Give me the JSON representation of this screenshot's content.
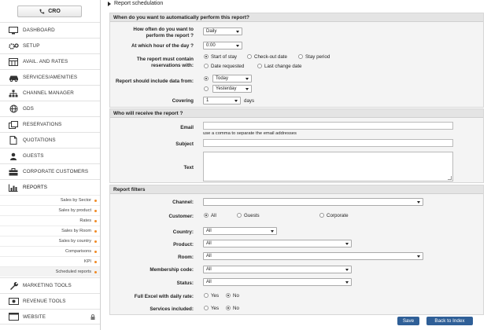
{
  "sidebar": {
    "cro_label": "CRO",
    "items": [
      {
        "label": "DASHBOARD",
        "icon": "monitor-icon"
      },
      {
        "label": "SETUP",
        "icon": "gears-icon"
      },
      {
        "label": "AVAIL. AND RATES",
        "icon": "rates-grid-icon"
      },
      {
        "label": "SERVICES/AMENITIES",
        "icon": "car-icon"
      },
      {
        "label": "CHANNEL MANAGER",
        "icon": "network-icon"
      },
      {
        "label": "GDS",
        "icon": "globe-icon"
      },
      {
        "label": "RESERVATIONS",
        "icon": "reservation-icon"
      },
      {
        "label": "QUOTATIONS",
        "icon": "document-icon"
      },
      {
        "label": "GUESTS",
        "icon": "user-icon"
      },
      {
        "label": "CORPORATE CUSTOMERS",
        "icon": "briefcase-icon"
      },
      {
        "label": "REPORTS",
        "icon": "bar-chart-icon"
      }
    ],
    "report_subitems": [
      "Sales by Sector",
      "Sales by product",
      "Rates",
      "Sales by Room",
      "Sales by country",
      "Comparisons",
      "KPI",
      "Scheduled reports"
    ],
    "bottom_items": [
      {
        "label": "MARKETING TOOLS",
        "icon": "wrench-icon"
      },
      {
        "label": "REVENUE TOOLS",
        "icon": "money-icon"
      },
      {
        "label": "WEBSITE",
        "icon": "browser-icon"
      }
    ],
    "dot_color": "#f08a24"
  },
  "breadcrumb": "Report schedulation",
  "when": {
    "header": "When do you want to automatically perform this report?",
    "frequency_label": "How often do you want to perform the report ?",
    "frequency_value": "Daily",
    "hour_label": "At which hour of the day ?",
    "hour_value": "0:00",
    "reservations_label": "The report must contain reservations with:",
    "res_options": [
      "Start of stay",
      "Check-out date",
      "Stay period",
      "Date requested",
      "Last change date"
    ],
    "include_label": "Report should include data from:",
    "include_options": [
      "Today",
      "Yesterday"
    ],
    "covering_label": "Covering",
    "covering_value": "1",
    "days_label": "days"
  },
  "who": {
    "header": "Who will receive the report ?",
    "email_label": "Email",
    "email_hint": "use a comma to separate the email addresses",
    "subject_label": "Subject",
    "text_label": "Text"
  },
  "filters": {
    "header": "Report filters",
    "channel_label": "Channel:",
    "channel_value": "",
    "customer_label": "Customer:",
    "customer_options": [
      "All",
      "Guests",
      "Corporate"
    ],
    "country_label": "Country:",
    "country_value": "All",
    "product_label": "Product:",
    "product_value": "All",
    "room_label": "Room:",
    "room_value": "All",
    "membership_label": "Membership code:",
    "membership_value": "All",
    "status_label": "Status:",
    "status_value": "All",
    "excel_label": "Full Excel with daily rate:",
    "services_label": "Services included:",
    "yes": "Yes",
    "no": "No"
  },
  "actions": {
    "save": "Save",
    "back": "Back to Index"
  },
  "colors": {
    "primary_button": "#2f5f97",
    "panel_bg": "#f4f4f4",
    "header_bg": "#e4e4e4"
  }
}
